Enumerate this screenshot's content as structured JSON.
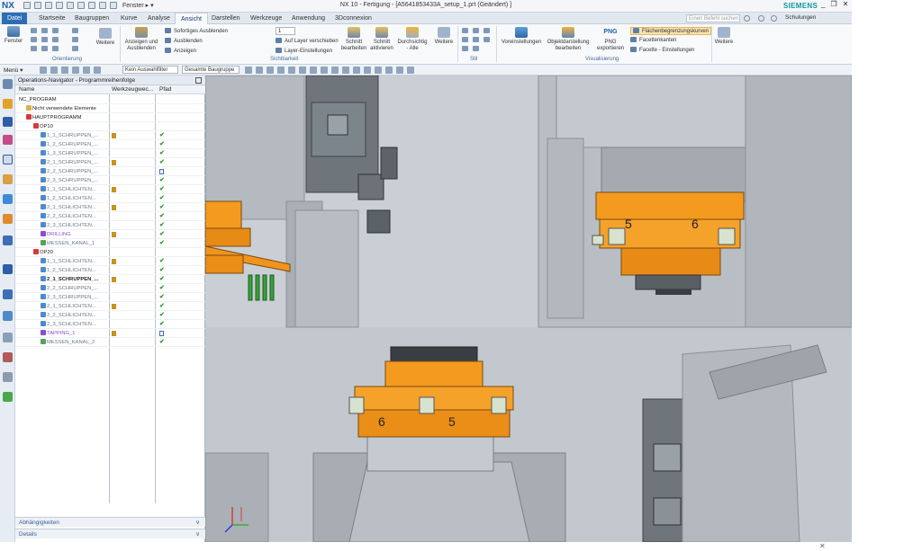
{
  "app": {
    "logo": "NX",
    "window_menu": "Fenster ▸ ▾",
    "title": "NX 10 - Fertigung - [A5641853433A_setup_1.prt (Geändert) ]",
    "brand": "SIEMENS",
    "window_controls": [
      "_",
      "❐",
      "✕"
    ]
  },
  "tabs": {
    "file": "Datei",
    "items": [
      "Startseite",
      "Baugruppen",
      "Kurve",
      "Analyse",
      "Ansicht",
      "Darstellen",
      "Werkzeuge",
      "Anwendung",
      "3Dconnexion"
    ],
    "active": "Ansicht",
    "search_placeholder": "Einen Befehl suchen",
    "schulungen": "Schulungen"
  },
  "ribbon": {
    "fenster": "Fenster",
    "orient_weitere": "Weitere",
    "orientierung": "Orientierung",
    "anzeigen_ausblenden": "Anzeigen und Ausblenden",
    "vis_list": [
      "Sofortiges Ausblenden",
      "Ausblenden",
      "Anzeigen"
    ],
    "layer_value": "1",
    "layer_list": [
      "Auf Layer verschieben",
      "Layer-Einstellungen"
    ],
    "schnitt_bearbeiten": "Schnitt bearbeiten",
    "schnitt_aktivieren": "Schnitt aktivieren",
    "durchsichtig": "Durchsichtig - Alle",
    "sichtbarkeit_weitere": "Weitere",
    "sichtbarkeit": "Sichtbarkeit",
    "stil": "Stil",
    "voreinstellungen": "Voreinstellungen",
    "objektdarstellung": "Objektdarstellung bearbeiten",
    "png": "PNG exportieren",
    "png_tag": "PNG",
    "vis_right": [
      "Flächenbegrenzungskurven",
      "Facettenkanten",
      "Facette - Einstellungen"
    ],
    "visualisierung": "Visualisierung",
    "right_weitere": "Weitere"
  },
  "toolbar": {
    "menu": "Menü ▾",
    "filter": "Kein Auswahlfilter",
    "assembly": "Gesamte Baugruppe"
  },
  "navigator": {
    "title": "Operations-Navigator - Programmreihenfolge",
    "col_name": "Name",
    "col_tool": "Werkzeugwec...",
    "col_path": "Pfad",
    "rows": [
      {
        "label": "NC_PROGRAM",
        "indent": 0,
        "kind": "root",
        "tool": false,
        "path": ""
      },
      {
        "label": "Nicht verwendete Elemente",
        "indent": 1,
        "kind": "folder",
        "tool": false,
        "path": ""
      },
      {
        "label": "HAUPTPROGRAMM",
        "indent": 1,
        "kind": "program",
        "tool": false,
        "path": ""
      },
      {
        "label": "OP10",
        "indent": 2,
        "kind": "program",
        "tool": false,
        "path": ""
      },
      {
        "label": "1_1_SCHRUPPEN_...",
        "indent": 3,
        "kind": "op",
        "tool": true,
        "path": "ok"
      },
      {
        "label": "1_2_SCHRUPPEN_...",
        "indent": 3,
        "kind": "op",
        "tool": false,
        "path": "ok"
      },
      {
        "label": "1_3_SCHRUPPEN_...",
        "indent": 3,
        "kind": "op",
        "tool": false,
        "path": "ok"
      },
      {
        "label": "2_1_SCHRUPPEN_...",
        "indent": 3,
        "kind": "op",
        "tool": true,
        "path": "ok"
      },
      {
        "label": "2_2_SCHRUPPEN_...",
        "indent": 3,
        "kind": "op",
        "tool": false,
        "path": "pending"
      },
      {
        "label": "2_3_SCHRUPPEN_...",
        "indent": 3,
        "kind": "op",
        "tool": false,
        "path": "ok"
      },
      {
        "label": "1_1_SCHLICHTEN...",
        "indent": 3,
        "kind": "op",
        "tool": true,
        "path": "ok"
      },
      {
        "label": "1_2_SCHLICHTEN...",
        "indent": 3,
        "kind": "op",
        "tool": false,
        "path": "ok"
      },
      {
        "label": "2_1_SCHLICHTEN...",
        "indent": 3,
        "kind": "op",
        "tool": true,
        "path": "ok"
      },
      {
        "label": "2_2_SCHLICHTEN...",
        "indent": 3,
        "kind": "op",
        "tool": false,
        "path": "ok"
      },
      {
        "label": "2_3_SCHLICHTEN...",
        "indent": 3,
        "kind": "op",
        "tool": false,
        "path": "ok"
      },
      {
        "label": "DRILLING",
        "indent": 3,
        "kind": "drill",
        "tool": true,
        "path": "ok"
      },
      {
        "label": "MESSEN_KANAL_1",
        "indent": 3,
        "kind": "measure",
        "tool": false,
        "path": "ok"
      },
      {
        "label": "OP20",
        "indent": 2,
        "kind": "program",
        "tool": false,
        "path": ""
      },
      {
        "label": "1_1_SCHLICHTEN...",
        "indent": 3,
        "kind": "op",
        "tool": true,
        "path": "ok"
      },
      {
        "label": "1_2_SCHLICHTEN...",
        "indent": 3,
        "kind": "op",
        "tool": false,
        "path": "ok"
      },
      {
        "label": "2_1_SCHRUPPEN_...",
        "indent": 3,
        "kind": "op-bold",
        "tool": true,
        "path": "ok"
      },
      {
        "label": "2_2_SCHRUPPEN_...",
        "indent": 3,
        "kind": "op",
        "tool": false,
        "path": "ok"
      },
      {
        "label": "2_3_SCHRUPPEN_...",
        "indent": 3,
        "kind": "op",
        "tool": false,
        "path": "ok"
      },
      {
        "label": "2_1_SCHLICHTEN...",
        "indent": 3,
        "kind": "op",
        "tool": true,
        "path": "ok"
      },
      {
        "label": "2_2_SCHLICHTEN...",
        "indent": 3,
        "kind": "op",
        "tool": false,
        "path": "ok"
      },
      {
        "label": "2_3_SCHLICHTEN...",
        "indent": 3,
        "kind": "op",
        "tool": false,
        "path": "ok"
      },
      {
        "label": "TAPPING_1",
        "indent": 3,
        "kind": "drill",
        "tool": true,
        "path": "pending"
      },
      {
        "label": "MESSEN_KANAL_2",
        "indent": 3,
        "kind": "measure",
        "tool": false,
        "path": "ok"
      }
    ],
    "panel_abh": "Abhängigkeiten",
    "panel_details": "Details"
  },
  "viewport": {
    "digits_upper": [
      "5",
      "6"
    ],
    "digits_lower": [
      "6",
      "5"
    ],
    "orange": "#f49a1f",
    "steel": "#8a9096"
  },
  "colors": {
    "accent": "#2d6db5",
    "check": "#2e9b2e",
    "drill": "#8a4fd0"
  }
}
